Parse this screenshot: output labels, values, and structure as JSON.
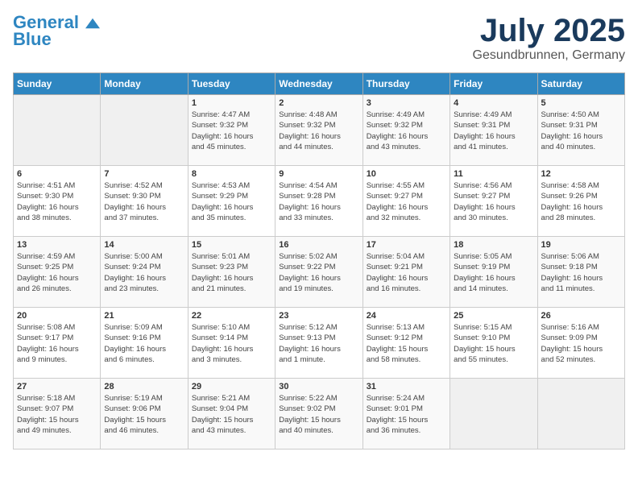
{
  "header": {
    "logo_line1": "General",
    "logo_line2": "Blue",
    "month": "July 2025",
    "location": "Gesundbrunnen, Germany"
  },
  "days_of_week": [
    "Sunday",
    "Monday",
    "Tuesday",
    "Wednesday",
    "Thursday",
    "Friday",
    "Saturday"
  ],
  "weeks": [
    [
      {
        "day": "",
        "info": ""
      },
      {
        "day": "",
        "info": ""
      },
      {
        "day": "1",
        "info": "Sunrise: 4:47 AM\nSunset: 9:32 PM\nDaylight: 16 hours\nand 45 minutes."
      },
      {
        "day": "2",
        "info": "Sunrise: 4:48 AM\nSunset: 9:32 PM\nDaylight: 16 hours\nand 44 minutes."
      },
      {
        "day": "3",
        "info": "Sunrise: 4:49 AM\nSunset: 9:32 PM\nDaylight: 16 hours\nand 43 minutes."
      },
      {
        "day": "4",
        "info": "Sunrise: 4:49 AM\nSunset: 9:31 PM\nDaylight: 16 hours\nand 41 minutes."
      },
      {
        "day": "5",
        "info": "Sunrise: 4:50 AM\nSunset: 9:31 PM\nDaylight: 16 hours\nand 40 minutes."
      }
    ],
    [
      {
        "day": "6",
        "info": "Sunrise: 4:51 AM\nSunset: 9:30 PM\nDaylight: 16 hours\nand 38 minutes."
      },
      {
        "day": "7",
        "info": "Sunrise: 4:52 AM\nSunset: 9:30 PM\nDaylight: 16 hours\nand 37 minutes."
      },
      {
        "day": "8",
        "info": "Sunrise: 4:53 AM\nSunset: 9:29 PM\nDaylight: 16 hours\nand 35 minutes."
      },
      {
        "day": "9",
        "info": "Sunrise: 4:54 AM\nSunset: 9:28 PM\nDaylight: 16 hours\nand 33 minutes."
      },
      {
        "day": "10",
        "info": "Sunrise: 4:55 AM\nSunset: 9:27 PM\nDaylight: 16 hours\nand 32 minutes."
      },
      {
        "day": "11",
        "info": "Sunrise: 4:56 AM\nSunset: 9:27 PM\nDaylight: 16 hours\nand 30 minutes."
      },
      {
        "day": "12",
        "info": "Sunrise: 4:58 AM\nSunset: 9:26 PM\nDaylight: 16 hours\nand 28 minutes."
      }
    ],
    [
      {
        "day": "13",
        "info": "Sunrise: 4:59 AM\nSunset: 9:25 PM\nDaylight: 16 hours\nand 26 minutes."
      },
      {
        "day": "14",
        "info": "Sunrise: 5:00 AM\nSunset: 9:24 PM\nDaylight: 16 hours\nand 23 minutes."
      },
      {
        "day": "15",
        "info": "Sunrise: 5:01 AM\nSunset: 9:23 PM\nDaylight: 16 hours\nand 21 minutes."
      },
      {
        "day": "16",
        "info": "Sunrise: 5:02 AM\nSunset: 9:22 PM\nDaylight: 16 hours\nand 19 minutes."
      },
      {
        "day": "17",
        "info": "Sunrise: 5:04 AM\nSunset: 9:21 PM\nDaylight: 16 hours\nand 16 minutes."
      },
      {
        "day": "18",
        "info": "Sunrise: 5:05 AM\nSunset: 9:19 PM\nDaylight: 16 hours\nand 14 minutes."
      },
      {
        "day": "19",
        "info": "Sunrise: 5:06 AM\nSunset: 9:18 PM\nDaylight: 16 hours\nand 11 minutes."
      }
    ],
    [
      {
        "day": "20",
        "info": "Sunrise: 5:08 AM\nSunset: 9:17 PM\nDaylight: 16 hours\nand 9 minutes."
      },
      {
        "day": "21",
        "info": "Sunrise: 5:09 AM\nSunset: 9:16 PM\nDaylight: 16 hours\nand 6 minutes."
      },
      {
        "day": "22",
        "info": "Sunrise: 5:10 AM\nSunset: 9:14 PM\nDaylight: 16 hours\nand 3 minutes."
      },
      {
        "day": "23",
        "info": "Sunrise: 5:12 AM\nSunset: 9:13 PM\nDaylight: 16 hours\nand 1 minute."
      },
      {
        "day": "24",
        "info": "Sunrise: 5:13 AM\nSunset: 9:12 PM\nDaylight: 15 hours\nand 58 minutes."
      },
      {
        "day": "25",
        "info": "Sunrise: 5:15 AM\nSunset: 9:10 PM\nDaylight: 15 hours\nand 55 minutes."
      },
      {
        "day": "26",
        "info": "Sunrise: 5:16 AM\nSunset: 9:09 PM\nDaylight: 15 hours\nand 52 minutes."
      }
    ],
    [
      {
        "day": "27",
        "info": "Sunrise: 5:18 AM\nSunset: 9:07 PM\nDaylight: 15 hours\nand 49 minutes."
      },
      {
        "day": "28",
        "info": "Sunrise: 5:19 AM\nSunset: 9:06 PM\nDaylight: 15 hours\nand 46 minutes."
      },
      {
        "day": "29",
        "info": "Sunrise: 5:21 AM\nSunset: 9:04 PM\nDaylight: 15 hours\nand 43 minutes."
      },
      {
        "day": "30",
        "info": "Sunrise: 5:22 AM\nSunset: 9:02 PM\nDaylight: 15 hours\nand 40 minutes."
      },
      {
        "day": "31",
        "info": "Sunrise: 5:24 AM\nSunset: 9:01 PM\nDaylight: 15 hours\nand 36 minutes."
      },
      {
        "day": "",
        "info": ""
      },
      {
        "day": "",
        "info": ""
      }
    ]
  ]
}
